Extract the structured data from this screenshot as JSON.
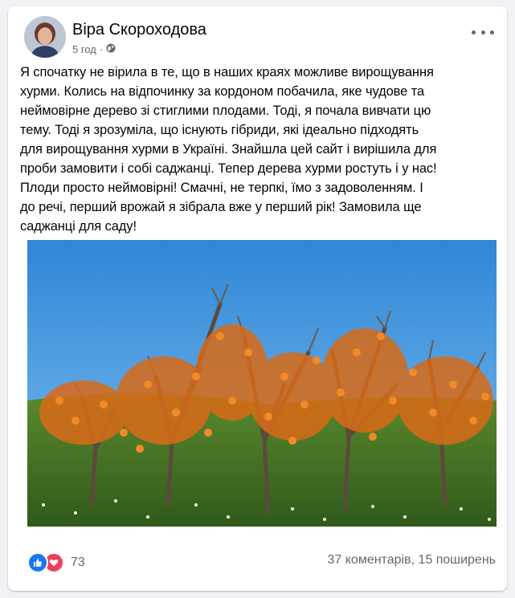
{
  "post": {
    "author": "Віра Скороходова",
    "time": "5 год",
    "separator": "·",
    "text": "Я спочатку не вірила в те, що в наших краях можливе вирощування\nхурми. Колись на відпочинку за кордоном побачила, яке чудове та\nнеймовірне дерево зі стиглими плодами. Тоді, я почала вивчати цю\nтему. Тоді я зрозуміла, що існують гібриди, які ідеально підходять\nдля вирощування хурми в Україні. Знайшла цей сайт і вирішила для\nпроби замовити і собі саджанці. Тепер  дерева хурми ростуть і у нас!\nПлоди просто неймовірні! Смачні, не терпкі, їмо з задоволенням. І\nдо речі, перший врожай я зібрала вже у перший рік!   Замовила   ще\nсаджанці для саду!",
    "reactions_count": "73",
    "stats": "37 коментарів, 15 поширень"
  },
  "icons": {
    "visibility": "globe-icon",
    "menu": "more-dots-icon",
    "reaction_like": "thumbs-up-icon",
    "reaction_love": "heart-icon"
  },
  "colors": {
    "like": "#1877f2",
    "love": "#f33e58",
    "secondary_text": "#65676b",
    "sky": "#3f93dc",
    "fruit": "#e8741a"
  }
}
